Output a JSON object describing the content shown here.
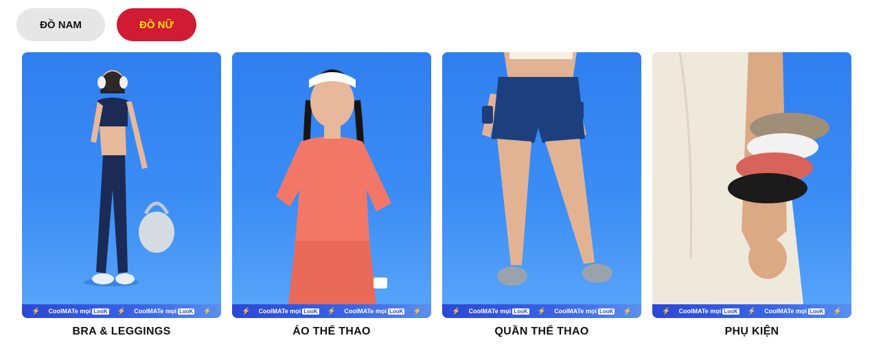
{
  "tabs": [
    {
      "label": "ĐỒ NAM",
      "active": false
    },
    {
      "label": "ĐỒ NỮ",
      "active": true
    }
  ],
  "colors": {
    "active_tab_bg": "#d11a33",
    "active_tab_text": "#ffe100",
    "inactive_tab_bg": "#e6e6e6",
    "card_bg": "#3b8df5"
  },
  "ticker": {
    "brand": "CoolMATe mọi",
    "badge": "LooK",
    "separator_icon": "lightning-icon"
  },
  "cards": [
    {
      "label": "BRA & LEGGINGS",
      "image": "model-in-sports-bra-and-leggings-with-gym-bag"
    },
    {
      "label": "ÁO THỂ THAO",
      "image": "model-in-coral-sports-tee-with-headband"
    },
    {
      "label": "QUẦN THỂ THAO",
      "image": "navy-running-shorts-and-sneakers"
    },
    {
      "label": "PHỤ KIỆN",
      "image": "hair-scrunchies-on-wrist"
    }
  ]
}
